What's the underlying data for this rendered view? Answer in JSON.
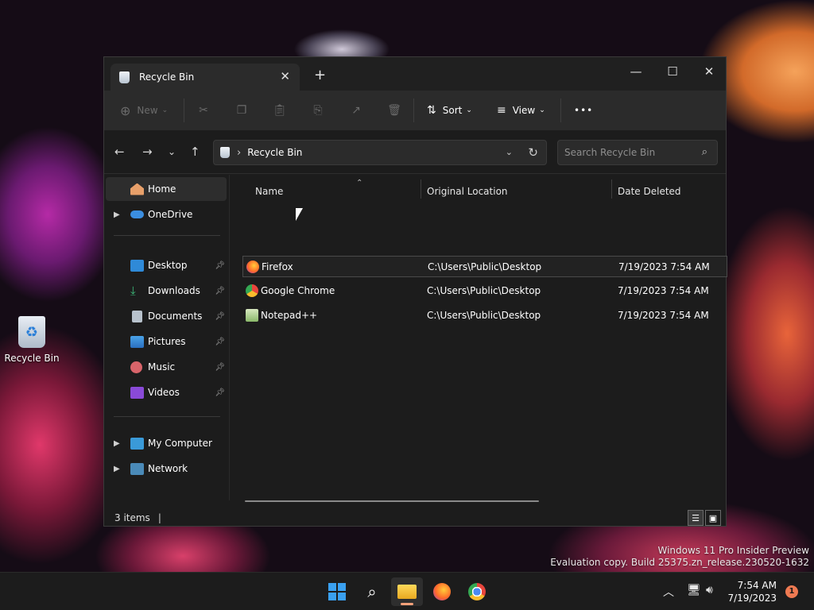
{
  "desktop": {
    "icon_label": "Recycle Bin",
    "watermark_line1": "Windows 11 Pro Insider Preview",
    "watermark_line2": "Evaluation copy. Build 25375.zn_release.230520-1632"
  },
  "window": {
    "tab_title": "Recycle Bin",
    "tab_close": "✕",
    "new_tab": "+",
    "controls": {
      "minimize": "—",
      "maximize": "☐",
      "close": "✕"
    }
  },
  "toolbar": {
    "new_label": "New",
    "sort_label": "Sort",
    "view_label": "View",
    "more_label": "•••",
    "icons": [
      "plus-circle-icon",
      "cut-icon",
      "copy-icon",
      "paste-icon",
      "rename-icon",
      "share-icon",
      "delete-icon",
      "sort-icon",
      "view-icon",
      "more-icon"
    ]
  },
  "address": {
    "path": "Recycle Bin",
    "search_placeholder": "Search Recycle Bin"
  },
  "sidebar": {
    "items": [
      {
        "label": "Home",
        "icon": "home-icon"
      },
      {
        "label": "OneDrive",
        "icon": "cloud-icon"
      },
      {
        "label": "Desktop",
        "icon": "desktop-icon"
      },
      {
        "label": "Downloads",
        "icon": "download-icon"
      },
      {
        "label": "Documents",
        "icon": "document-icon"
      },
      {
        "label": "Pictures",
        "icon": "pictures-icon"
      },
      {
        "label": "Music",
        "icon": "music-icon"
      },
      {
        "label": "Videos",
        "icon": "video-icon"
      },
      {
        "label": "My Computer",
        "icon": "computer-icon"
      },
      {
        "label": "Network",
        "icon": "network-icon"
      }
    ]
  },
  "columns": {
    "name": "Name",
    "location": "Original Location",
    "date": "Date Deleted"
  },
  "files": [
    {
      "name": "Firefox",
      "location": "C:\\Users\\Public\\Desktop",
      "date": "7/19/2023 7:54 AM"
    },
    {
      "name": "Google Chrome",
      "location": "C:\\Users\\Public\\Desktop",
      "date": "7/19/2023 7:54 AM"
    },
    {
      "name": "Notepad++",
      "location": "C:\\Users\\Public\\Desktop",
      "date": "7/19/2023 7:54 AM"
    }
  ],
  "status": {
    "count": "3 items"
  },
  "taskbar": {
    "time": "7:54 AM",
    "date": "7/19/2023",
    "notifications": "1"
  },
  "colors": {
    "accent": "#f2a07a",
    "window_bg": "#1c1c1c",
    "toolbar_bg": "#2b2b2b"
  }
}
